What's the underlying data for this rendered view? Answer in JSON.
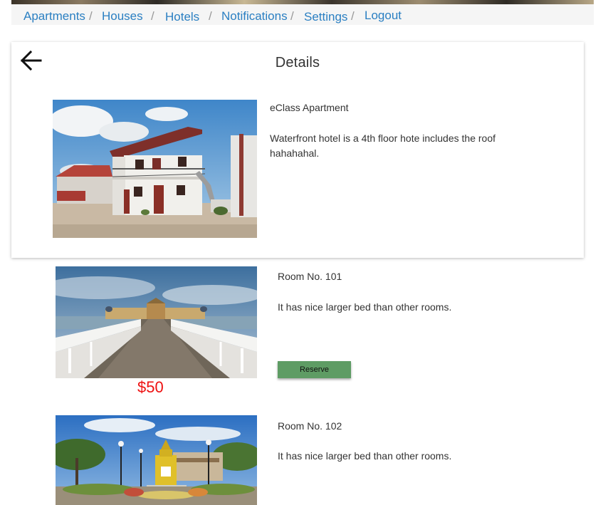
{
  "nav": {
    "items": [
      {
        "label": "Apartments"
      },
      {
        "label": "Houses"
      },
      {
        "label": "Hotels"
      },
      {
        "label": "Notifications"
      },
      {
        "label": "Settings"
      },
      {
        "label": "Logout"
      }
    ],
    "separator": "/"
  },
  "details": {
    "title": "Details",
    "back_icon": "arrow-left-icon",
    "property_name": "eClass Apartment",
    "property_description": "Waterfront hotel is a 4th floor hote includes the roof hahahahal."
  },
  "rooms": [
    {
      "name": "Room No. 101",
      "description": "It has  nice larger bed than other rooms.",
      "price": "$50",
      "reserve_label": "Reserve"
    },
    {
      "name": "Room No. 102",
      "description": "It has  nice larger bed than other rooms."
    }
  ],
  "colors": {
    "nav_link": "#2a7fc2",
    "price": "#ee1111",
    "reserve_button": "#5e9c64"
  }
}
